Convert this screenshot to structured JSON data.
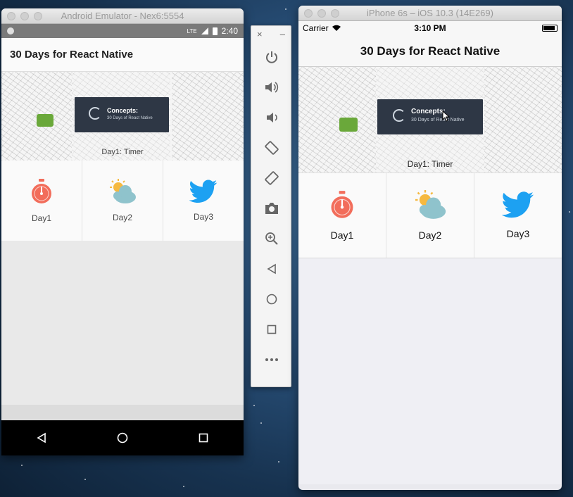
{
  "android": {
    "window_title": "Android Emulator - Nex6:5554",
    "status_time": "2:40",
    "status_lte": "LTE",
    "app_title": "30 Days for React Native",
    "banner_card_title": "Concepts:",
    "banner_card_subtitle": "30 Days of React Native",
    "banner_caption": "Day1: Timer",
    "days": [
      {
        "label": "Day1",
        "icon": "stopwatch-icon"
      },
      {
        "label": "Day2",
        "icon": "partly-cloudy-icon"
      },
      {
        "label": "Day3",
        "icon": "twitter-bird-icon"
      }
    ],
    "nav_buttons": [
      "back-icon",
      "home-icon",
      "recents-icon"
    ]
  },
  "ios": {
    "window_title": "iPhone 6s – iOS 10.3 (14E269)",
    "carrier": "Carrier",
    "status_time": "3:10 PM",
    "app_title": "30 Days for React Native",
    "banner_card_title": "Concepts:",
    "banner_card_subtitle": "30 Days of React Native",
    "banner_caption": "Day1: Timer",
    "days": [
      {
        "label": "Day1",
        "icon": "stopwatch-icon"
      },
      {
        "label": "Day2",
        "icon": "partly-cloudy-icon"
      },
      {
        "label": "Day3",
        "icon": "twitter-bird-icon"
      }
    ]
  },
  "toolbar": {
    "close_glyph": "×",
    "minimize_glyph": "–",
    "buttons": [
      "power-icon",
      "volume-up-icon",
      "volume-down-icon",
      "rotate-left-icon",
      "rotate-right-icon",
      "camera-icon",
      "zoom-icon",
      "back-icon",
      "home-icon",
      "overview-icon",
      "more-icon"
    ]
  },
  "colors": {
    "timer": "#f26d5b",
    "cloud": "#8fc3cc",
    "sun": "#f5b940",
    "twitter": "#1da1f2",
    "concept_card": "#2e3745"
  }
}
